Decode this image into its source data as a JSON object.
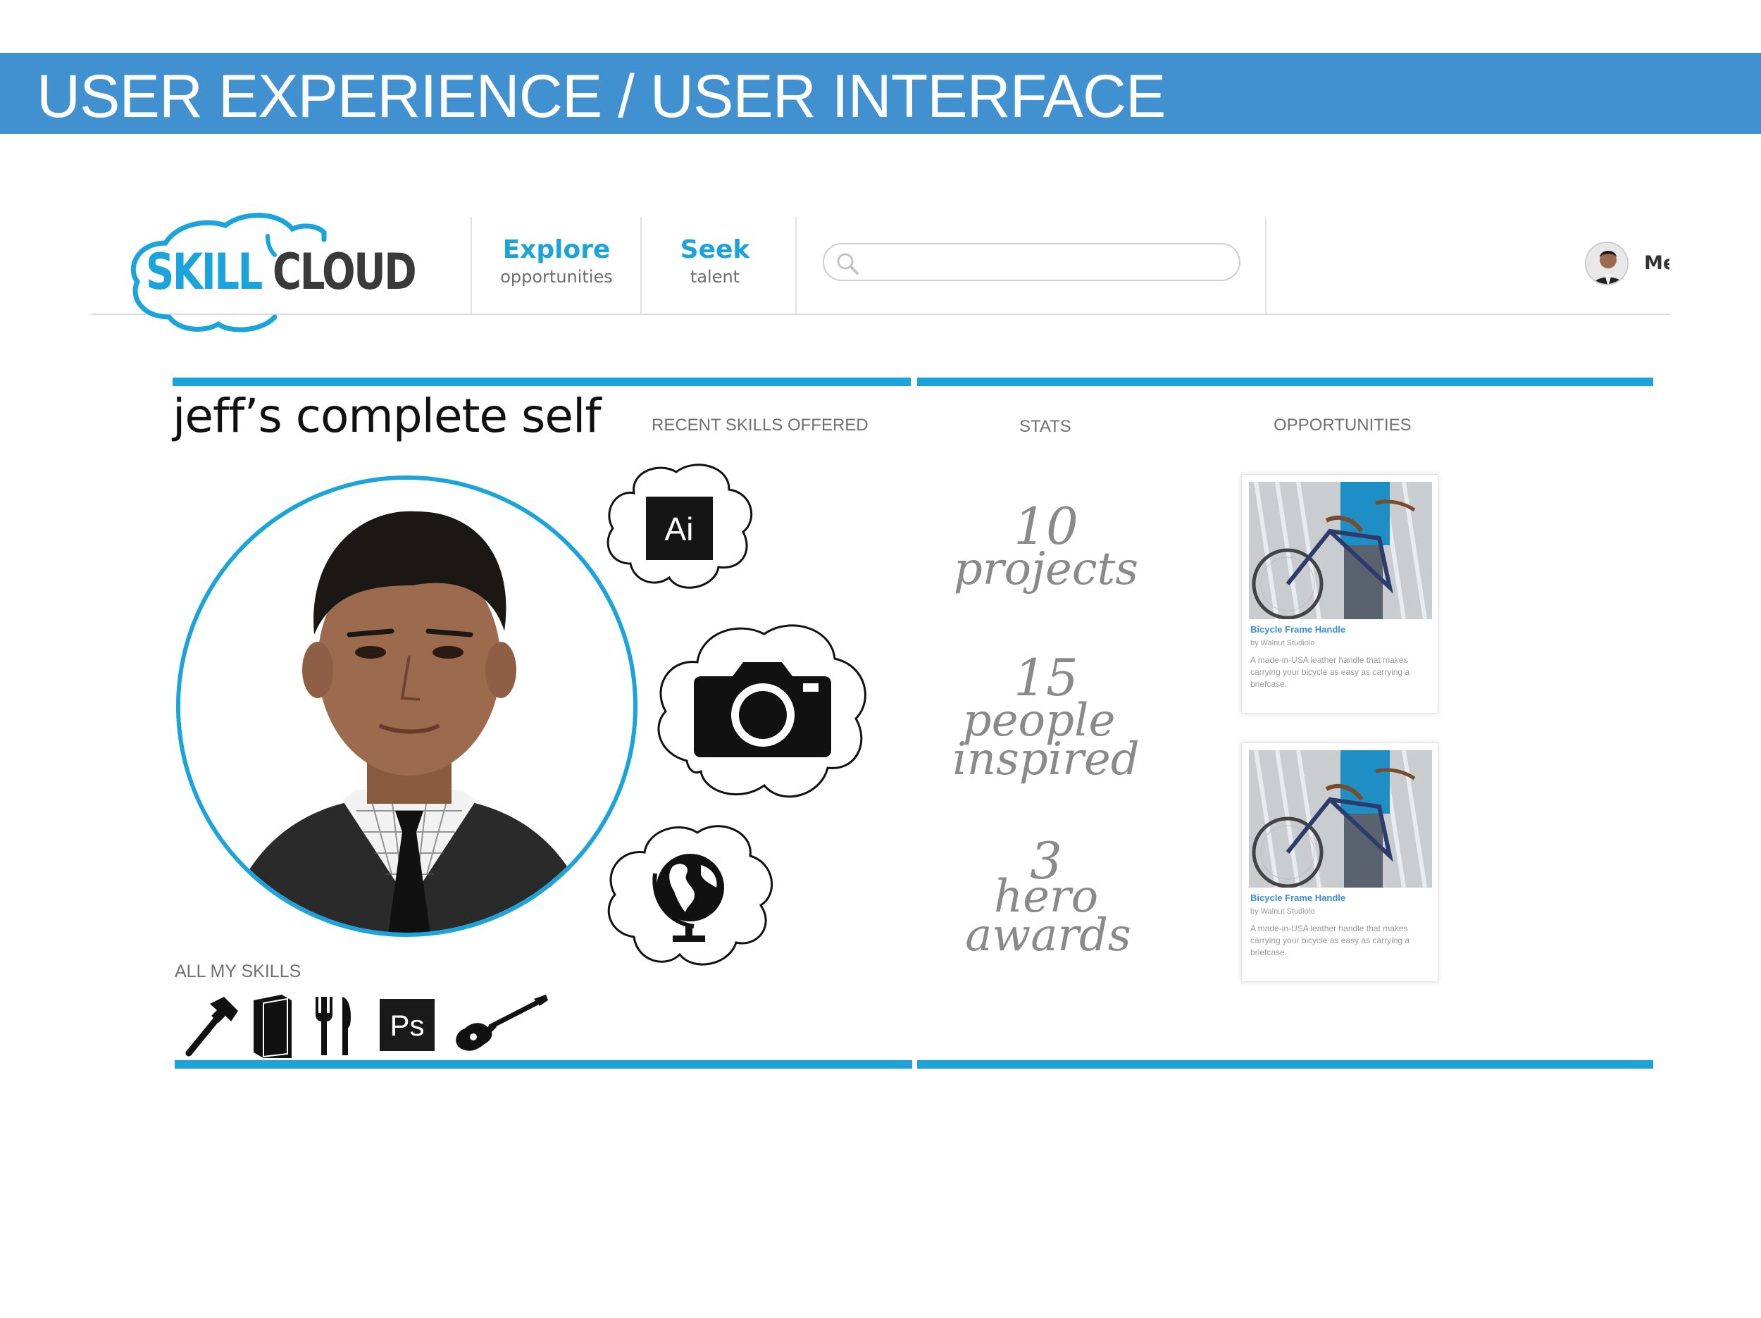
{
  "slide": {
    "title": "USER EXPERIENCE / USER INTERFACE",
    "banner_color": "#4190cf"
  },
  "header": {
    "logo": {
      "part1": "SKILL",
      "part2": "CLOUD"
    },
    "nav": [
      {
        "label": "Explore",
        "sublabel": "opportunities"
      },
      {
        "label": "Seek",
        "sublabel": "talent"
      }
    ],
    "search": {
      "placeholder": "",
      "value": ""
    },
    "user": {
      "label": "Me",
      "avatar_icon": "user-avatar"
    }
  },
  "profile": {
    "title": "jeff’s complete self",
    "recent_skills_label": "RECENT SKILLS OFFERED",
    "recent_skills": [
      "illustrator-icon",
      "camera-icon",
      "globe-icon"
    ],
    "all_skills_label": "ALL MY SKILLS",
    "all_skills": [
      "hammer-icon",
      "book-icon",
      "fork-knife-icon",
      "photoshop-icon",
      "guitar-icon"
    ],
    "ai_text": "Ai",
    "ps_text": "Ps"
  },
  "stats": {
    "label": "STATS",
    "items": [
      {
        "number": "10",
        "text_line1": "projects",
        "text_line2": ""
      },
      {
        "number": "15",
        "text_line1": "people",
        "text_line2": "inspired"
      },
      {
        "number": "3",
        "text_line1": "hero",
        "text_line2": "awards"
      }
    ]
  },
  "opportunities": {
    "label": "OPPORTUNITIES",
    "items": [
      {
        "title": "Bicycle Frame Handle",
        "by": "by Walnut Studiolo",
        "description": "A made-in-USA leather handle that makes carrying your bicycle as easy as carrying a briefcase."
      },
      {
        "title": "Bicycle Frame Handle",
        "by": "by Walnut Studiolo",
        "description": "A made-in-USA leather handle that makes carrying your bicycle as easy as carrying a briefcase."
      }
    ]
  },
  "colors": {
    "accent": "#1ba3dc",
    "stat_text": "#8a8a8a",
    "link": "#3b8fd0"
  }
}
